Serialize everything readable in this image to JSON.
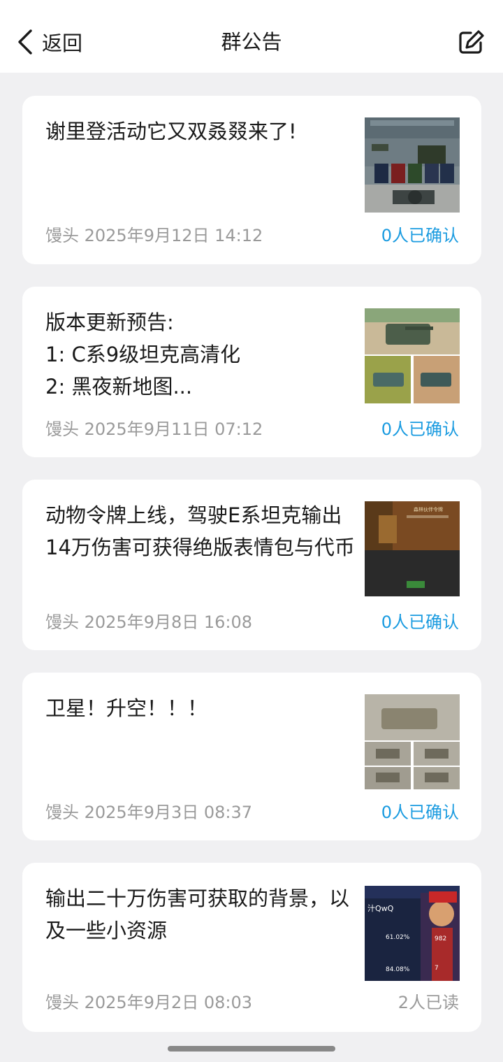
{
  "header": {
    "back_label": "返回",
    "title": "群公告"
  },
  "announcements": [
    {
      "text": "谢里登活动它又双叒叕来了!",
      "meta": "馒头 2025年9月12日 14:12",
      "status": "0人已确认"
    },
    {
      "text": "版本更新预告:\n1: C系9级坦克高清化\n2: 黑夜新地图...",
      "meta": "馒头 2025年9月11日 07:12",
      "status": "0人已确认"
    },
    {
      "text": "动物令牌上线，驾驶E系坦克输出14万伤害可获得绝版表情包与代币",
      "meta": "馒头 2025年9月8日 16:08",
      "status": "0人已确认"
    },
    {
      "text": "卫星！升空！！！",
      "meta": "馒头 2025年9月3日 08:37",
      "status": "0人已确认"
    },
    {
      "text": "输出二十万伤害可获取的背景，以及一些小资源",
      "meta": "馒头 2025年9月2日 08:03",
      "status": "2人已读"
    }
  ],
  "thumbnail_text": {
    "t3_title": "森林伙伴令牌",
    "t5_name": "汁QwQ",
    "t5_pct1": "61.02%",
    "t5_pct2": "84.08%",
    "t5_num1": "982",
    "t5_num2": "7"
  }
}
